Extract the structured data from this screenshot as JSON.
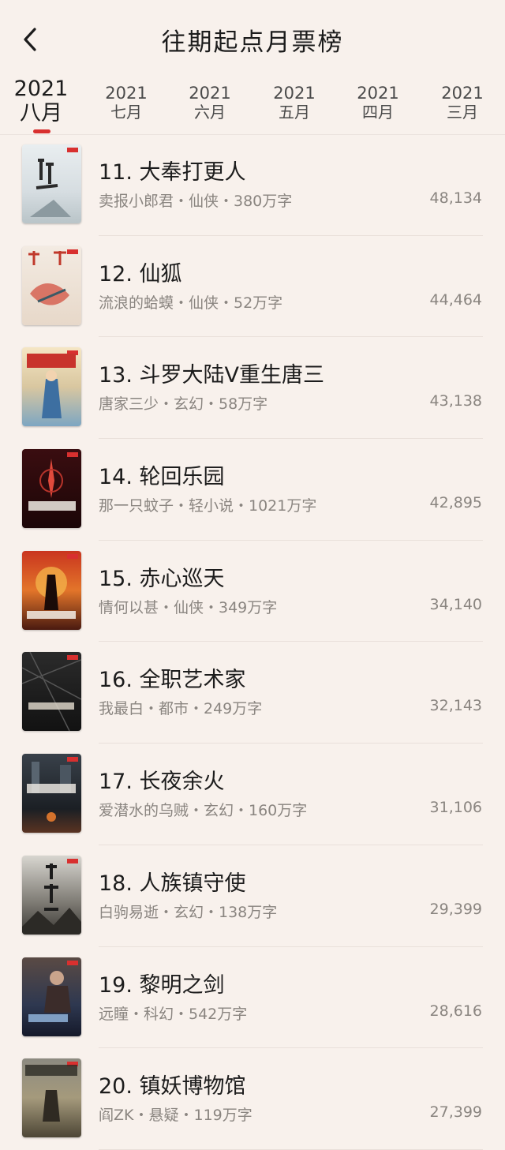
{
  "header": {
    "title": "往期起点月票榜",
    "back_icon": "chevron-left-icon"
  },
  "tabs": [
    {
      "year": "2021",
      "month": "八月",
      "active": true
    },
    {
      "year": "2021",
      "month": "七月",
      "active": false
    },
    {
      "year": "2021",
      "month": "六月",
      "active": false
    },
    {
      "year": "2021",
      "month": "五月",
      "active": false
    },
    {
      "year": "2021",
      "month": "四月",
      "active": false
    },
    {
      "year": "2021",
      "month": "三月",
      "active": false
    }
  ],
  "colors": {
    "accent": "#d8302f",
    "background": "#f8f1ec"
  },
  "books": [
    {
      "title": "11. 大奉打更人",
      "meta": "卖报小郎君・仙侠・380万字",
      "votes": "48,134"
    },
    {
      "title": "12. 仙狐",
      "meta": "流浪的蛤蟆・仙侠・52万字",
      "votes": "44,464"
    },
    {
      "title": "13. 斗罗大陆V重生唐三",
      "meta": "唐家三少・玄幻・58万字",
      "votes": "43,138"
    },
    {
      "title": "14. 轮回乐园",
      "meta": "那一只蚊子・轻小说・1021万字",
      "votes": "42,895"
    },
    {
      "title": "15. 赤心巡天",
      "meta": "情何以甚・仙侠・349万字",
      "votes": "34,140"
    },
    {
      "title": "16. 全职艺术家",
      "meta": "我最白・都市・249万字",
      "votes": "32,143"
    },
    {
      "title": "17. 长夜余火",
      "meta": "爱潜水的乌贼・玄幻・160万字",
      "votes": "31,106"
    },
    {
      "title": "18. 人族镇守使",
      "meta": "白驹易逝・玄幻・138万字",
      "votes": "29,399"
    },
    {
      "title": "19. 黎明之剑",
      "meta": "远瞳・科幻・542万字",
      "votes": "28,616"
    },
    {
      "title": "20. 镇妖博物馆",
      "meta": "阎ZK・悬疑・119万字",
      "votes": "27,399"
    }
  ]
}
